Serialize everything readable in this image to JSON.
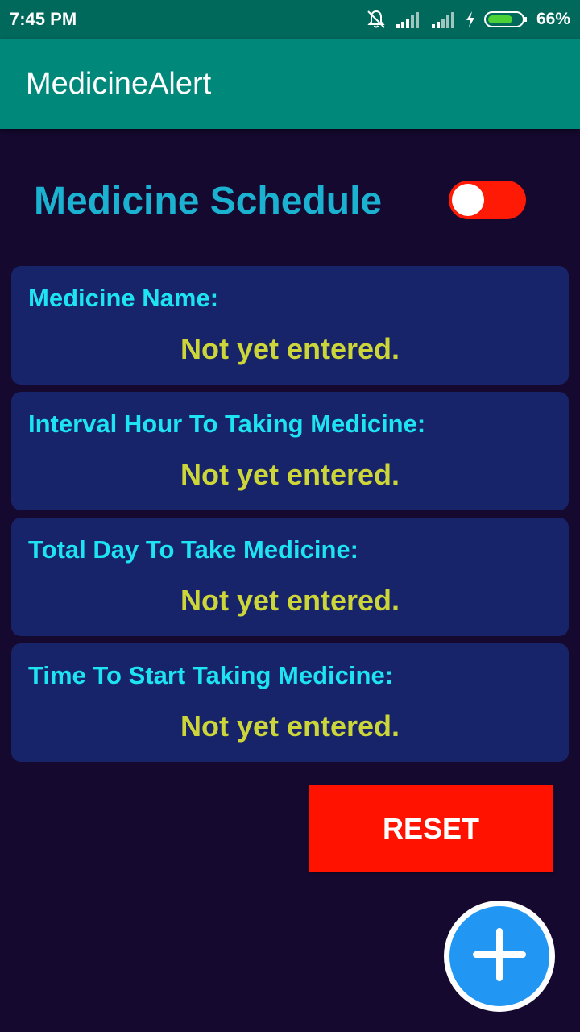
{
  "status_bar": {
    "time": "7:45 PM",
    "battery_percent": "66%",
    "icons": [
      "bell-off-icon",
      "signal-icon",
      "signal-icon",
      "charging-icon",
      "battery-icon"
    ]
  },
  "app_bar": {
    "title": "MedicineAlert"
  },
  "schedule": {
    "title": "Medicine Schedule",
    "toggle_on": false
  },
  "cards": [
    {
      "label": "Medicine Name:",
      "value": "Not yet entered."
    },
    {
      "label": "Interval Hour To Taking Medicine:",
      "value": "Not yet entered."
    },
    {
      "label": "Total Day To Take Medicine:",
      "value": "Not yet entered."
    },
    {
      "label": "Time To Start Taking Medicine:",
      "value": "Not yet entered."
    }
  ],
  "reset_button": {
    "label": "RESET"
  },
  "fab": {
    "icon": "plus-icon"
  },
  "colors": {
    "background": "#160930",
    "app_bar": "#00897b",
    "status_bar": "#00695c",
    "title": "#1ab2d0",
    "card": "#182469",
    "card_label": "#1de3f2",
    "card_value": "#cdd639",
    "reset": "#ff1200",
    "toggle_track": "#ff1a05",
    "fab": "#2196f3"
  }
}
